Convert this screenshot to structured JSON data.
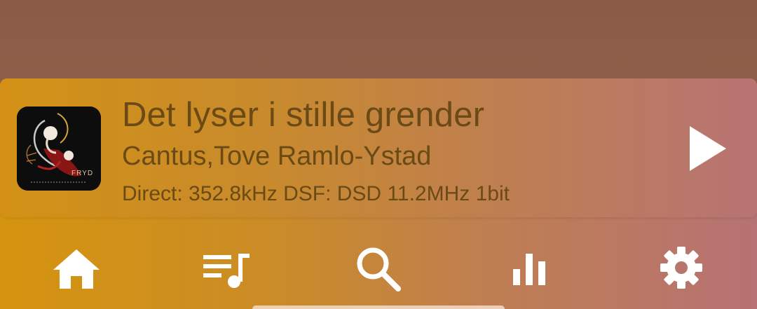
{
  "now_playing": {
    "title": "Det lyser i stille grender",
    "artist": "Cantus,Tove Ramlo-Ystad",
    "format": "Direct: 352.8kHz  DSF: DSD 11.2MHz  1bit",
    "album_art_text": "FRYD"
  },
  "controls": {
    "play_icon": "play-icon"
  },
  "bottom_nav": [
    {
      "name": "home",
      "icon": "home-icon"
    },
    {
      "name": "queue",
      "icon": "queue-music-icon"
    },
    {
      "name": "search",
      "icon": "search-icon"
    },
    {
      "name": "stats",
      "icon": "bar-chart-icon"
    },
    {
      "name": "settings",
      "icon": "gear-icon"
    }
  ],
  "colors": {
    "text": "#6b4a16",
    "icon": "#ffffff"
  }
}
